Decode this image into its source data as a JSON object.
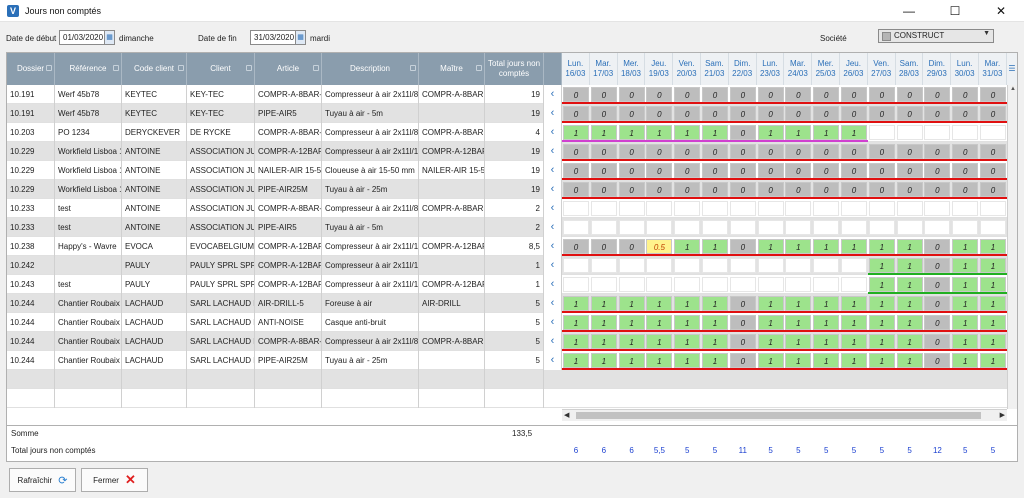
{
  "window": {
    "title": "Jours non comptés",
    "app_icon": "app-logo-icon"
  },
  "filters": {
    "start_label": "Date de début",
    "start_value": "01/03/2020",
    "start_day": "dimanche",
    "end_label": "Date de fin",
    "end_value": "31/03/2020",
    "end_day": "mardi",
    "company_label": "Société",
    "company_value": "CONSTRUCT"
  },
  "columns": [
    "Dossier",
    "Référence",
    "Code client",
    "Client",
    "Article",
    "Description",
    "Maître",
    "Total jours non comptés"
  ],
  "days": [
    {
      "name": "Lun.",
      "date": "16/03"
    },
    {
      "name": "Mar.",
      "date": "17/03"
    },
    {
      "name": "Mer.",
      "date": "18/03"
    },
    {
      "name": "Jeu.",
      "date": "19/03"
    },
    {
      "name": "Ven.",
      "date": "20/03"
    },
    {
      "name": "Sam.",
      "date": "21/03"
    },
    {
      "name": "Dim.",
      "date": "22/03"
    },
    {
      "name": "Lun.",
      "date": "23/03"
    },
    {
      "name": "Mar.",
      "date": "24/03"
    },
    {
      "name": "Mer.",
      "date": "25/03"
    },
    {
      "name": "Jeu.",
      "date": "26/03"
    },
    {
      "name": "Ven.",
      "date": "27/03"
    },
    {
      "name": "Sam.",
      "date": "28/03"
    },
    {
      "name": "Dim.",
      "date": "29/03"
    },
    {
      "name": "Lun.",
      "date": "30/03"
    },
    {
      "name": "Mar.",
      "date": "31/03"
    }
  ],
  "rows": [
    {
      "dossier": "10.191",
      "ref": "Werf 45b78",
      "code": "KEYTEC",
      "client": "KEY-TEC",
      "article": "COMPR-A-8BAR-5",
      "desc": "Compresseur à air 2x11l/8",
      "maitre": "COMPR-A-8BAR",
      "total": "19",
      "cells": [
        "0",
        "0",
        "0",
        "0",
        "0",
        "0",
        "0",
        "0",
        "0",
        "0",
        "0",
        "0",
        "0",
        "0",
        "0",
        "0"
      ],
      "types": "rrrrrrrrrrrrrrrr",
      "line": "red"
    },
    {
      "dossier": "10.191",
      "ref": "Werf 45b78",
      "code": "KEYTEC",
      "client": "KEY-TEC",
      "article": "PIPE-AIR5",
      "desc": "Tuyau à air - 5m",
      "maitre": "",
      "total": "19",
      "cells": [
        "0",
        "0",
        "0",
        "0",
        "0",
        "0",
        "0",
        "0",
        "0",
        "0",
        "0",
        "0",
        "0",
        "0",
        "0",
        "0"
      ],
      "types": "rrrrrrrrrrrrrrrr",
      "line": "red"
    },
    {
      "dossier": "10.203",
      "ref": "PO 1234",
      "code": "DERYCKEVER",
      "client": "DE RYCKE",
      "article": "COMPR-A-8BAR-7",
      "desc": "Compresseur à air 2x11l/8",
      "maitre": "COMPR-A-8BAR",
      "total": "4",
      "cells": [
        "1",
        "1",
        "1",
        "1",
        "1",
        "1",
        "0",
        "1",
        "1",
        "1",
        "1",
        "",
        "",
        "",
        "",
        ""
      ],
      "types": "gggggg-ggggwwwww",
      "line": "magenta"
    },
    {
      "dossier": "10.229",
      "ref": "Workfield Lisboa 1",
      "code": "ANTOINE",
      "client": "ASSOCIATION JUPRI",
      "article": "COMPR-A-12BAR-4",
      "desc": "Compresseur à air 2x11l/1",
      "maitre": "COMPR-A-12BAR",
      "total": "19",
      "cells": [
        "0",
        "0",
        "0",
        "0",
        "0",
        "0",
        "0",
        "0",
        "0",
        "0",
        "0",
        "0",
        "0",
        "0",
        "0",
        "0"
      ],
      "types": "rrrrrrrrrrrrrrrr",
      "line": "red"
    },
    {
      "dossier": "10.229",
      "ref": "Workfield Lisboa 1",
      "code": "ANTOINE",
      "client": "ASSOCIATION JUPRI",
      "article": "NAILER-AIR 15-50M",
      "desc": "Cloueuse à air 15-50 mm",
      "maitre": "NAILER-AIR 15-50M",
      "total": "19",
      "cells": [
        "0",
        "0",
        "0",
        "0",
        "0",
        "0",
        "0",
        "0",
        "0",
        "0",
        "0",
        "0",
        "0",
        "0",
        "0",
        "0"
      ],
      "types": "rrrrrrrrrrrrrrrr",
      "line": "red"
    },
    {
      "dossier": "10.229",
      "ref": "Workfield Lisboa 1",
      "code": "ANTOINE",
      "client": "ASSOCIATION JUPRI",
      "article": "PIPE-AIR25M",
      "desc": "Tuyau à air - 25m",
      "maitre": "",
      "total": "19",
      "cells": [
        "0",
        "0",
        "0",
        "0",
        "0",
        "0",
        "0",
        "0",
        "0",
        "0",
        "0",
        "0",
        "0",
        "0",
        "0",
        "0"
      ],
      "types": "rrrrrrrrrrrrrrrr",
      "line": "red"
    },
    {
      "dossier": "10.233",
      "ref": "test",
      "code": "ANTOINE",
      "client": "ASSOCIATION JUPRI",
      "article": "COMPR-A-8BAR-9",
      "desc": "Compresseur à air 2x11l/8",
      "maitre": "COMPR-A-8BAR",
      "total": "2",
      "cells": [
        "",
        "",
        "",
        "",
        "",
        "",
        "",
        "",
        "",
        "",
        "",
        "",
        "",
        "",
        "",
        ""
      ],
      "types": "wwwwwwwwwwwwwwww",
      "line": ""
    },
    {
      "dossier": "10.233",
      "ref": "test",
      "code": "ANTOINE",
      "client": "ASSOCIATION JUPRI",
      "article": "PIPE-AIR5",
      "desc": "Tuyau à air - 5m",
      "maitre": "",
      "total": "2",
      "cells": [
        "",
        "",
        "",
        "",
        "",
        "",
        "",
        "",
        "",
        "",
        "",
        "",
        "",
        "",
        "",
        ""
      ],
      "types": "wwwwwwwwwwwwwwww",
      "line": ""
    },
    {
      "dossier": "10.238",
      "ref": "Happy's - Wavre",
      "code": "EVOCA",
      "client": "EVOCABELGIUM",
      "article": "COMPR-A-12BAR-9",
      "desc": "Compresseur à air 2x11l/1",
      "maitre": "COMPR-A-12BAR",
      "total": "8,5",
      "cells": [
        "0",
        "0",
        "0",
        "0.5",
        "1",
        "1",
        "0",
        "1",
        "1",
        "1",
        "1",
        "1",
        "1",
        "0",
        "1",
        "1"
      ],
      "types": "rrrygg-gggggg-gg",
      "line": "red"
    },
    {
      "dossier": "10.242",
      "ref": "",
      "code": "PAULY",
      "client": "PAULY SPRL SPRL",
      "article": "COMPR-A-12BAR",
      "desc": "Compresseur à air 2x11l/1",
      "maitre": "",
      "total": "1",
      "cells": [
        "",
        "",
        "",
        "",
        "",
        "",
        "",
        "",
        "",
        "",
        "",
        "1",
        "1",
        "0",
        "1",
        "1"
      ],
      "types": "wwwwwwwwwwwgg-gg",
      "line": "green"
    },
    {
      "dossier": "10.243",
      "ref": "test",
      "code": "PAULY",
      "client": "PAULY SPRL SPRL",
      "article": "COMPR-A-12BAR-9",
      "desc": "Compresseur à air 2x11l/1",
      "maitre": "COMPR-A-12BAR",
      "total": "1",
      "cells": [
        "",
        "",
        "",
        "",
        "",
        "",
        "",
        "",
        "",
        "",
        "",
        "1",
        "1",
        "0",
        "1",
        "1"
      ],
      "types": "wwwwwwwwwwwgg-gg",
      "line": "green"
    },
    {
      "dossier": "10.244",
      "ref": "Chantier Roubaix",
      "code": "LACHAUD",
      "client": "SARL LACHAUD LOC",
      "article": "AIR-DRILL-5",
      "desc": "Foreuse à air",
      "maitre": "AIR-DRILL",
      "total": "5",
      "cells": [
        "1",
        "1",
        "1",
        "1",
        "1",
        "1",
        "0",
        "1",
        "1",
        "1",
        "1",
        "1",
        "1",
        "0",
        "1",
        "1"
      ],
      "types": "gggggg-gggggg-gg",
      "line": "red"
    },
    {
      "dossier": "10.244",
      "ref": "Chantier Roubaix",
      "code": "LACHAUD",
      "client": "SARL LACHAUD LOC",
      "article": "ANTI-NOISE",
      "desc": "Casque anti-bruit",
      "maitre": "",
      "total": "5",
      "cells": [
        "1",
        "1",
        "1",
        "1",
        "1",
        "1",
        "0",
        "1",
        "1",
        "1",
        "1",
        "1",
        "1",
        "0",
        "1",
        "1"
      ],
      "types": "gggggg-gggggg-gg",
      "line": "red"
    },
    {
      "dossier": "10.244",
      "ref": "Chantier Roubaix",
      "code": "LACHAUD",
      "client": "SARL LACHAUD LOC",
      "article": "COMPR-A-8BAR-8",
      "desc": "Compresseur à air 2x11l/8",
      "maitre": "COMPR-A-8BAR",
      "total": "5",
      "cells": [
        "1",
        "1",
        "1",
        "1",
        "1",
        "1",
        "0",
        "1",
        "1",
        "1",
        "1",
        "1",
        "1",
        "0",
        "1",
        "1"
      ],
      "types": "gggggg-gggggg-gg",
      "line": "red"
    },
    {
      "dossier": "10.244",
      "ref": "Chantier Roubaix",
      "code": "LACHAUD",
      "client": "SARL LACHAUD LOC",
      "article": "PIPE-AIR25M",
      "desc": "Tuyau à air - 25m",
      "maitre": "",
      "total": "5",
      "cells": [
        "1",
        "1",
        "1",
        "1",
        "1",
        "1",
        "0",
        "1",
        "1",
        "1",
        "1",
        "1",
        "1",
        "0",
        "1",
        "1"
      ],
      "types": "gggggg-gggggg-gg",
      "line": "red"
    }
  ],
  "summary": {
    "sum_label": "Somme",
    "sum_value": "133,5",
    "total_label": "Total jours non comptés",
    "day_totals": [
      "6",
      "6",
      "6",
      "5,5",
      "5",
      "5",
      "11",
      "5",
      "5",
      "5",
      "5",
      "5",
      "5",
      "12",
      "5",
      "5"
    ]
  },
  "buttons": {
    "refresh": "Rafraîchir",
    "close": "Fermer"
  },
  "colors": {
    "header": "#8a9dad",
    "green": "#9de38c",
    "gray": "#bdbdbd",
    "yellow": "#fff38c",
    "red_line": "#e01010"
  }
}
